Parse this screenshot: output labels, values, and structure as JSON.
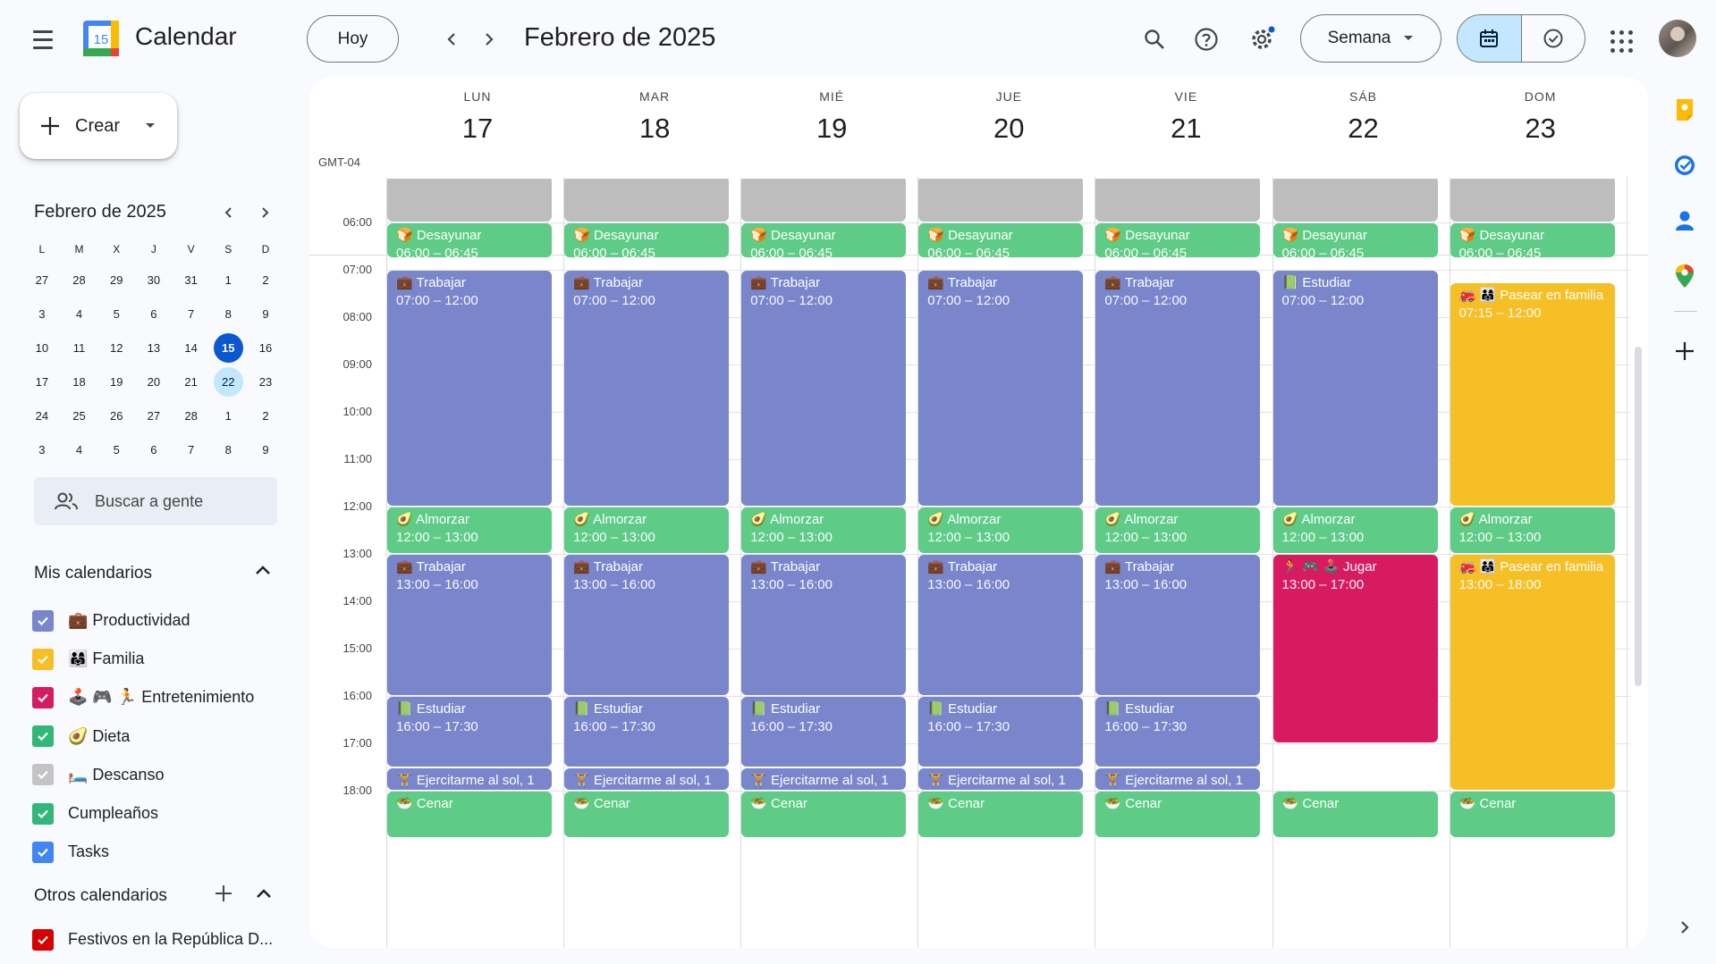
{
  "app": {
    "title": "Calendar",
    "logo_day": "15"
  },
  "header": {
    "today_label": "Hoy",
    "period_title": "Febrero de 2025",
    "view_label": "Semana"
  },
  "sidebar": {
    "create_label": "Crear",
    "mini_month": "Febrero de 2025",
    "mini_dow": [
      "L",
      "M",
      "X",
      "J",
      "V",
      "S",
      "D"
    ],
    "mini_weeks": [
      [
        "27",
        "28",
        "29",
        "30",
        "31",
        "1",
        "2"
      ],
      [
        "3",
        "4",
        "5",
        "6",
        "7",
        "8",
        "9"
      ],
      [
        "10",
        "11",
        "12",
        "13",
        "14",
        "15",
        "16"
      ],
      [
        "17",
        "18",
        "19",
        "20",
        "21",
        "22",
        "23"
      ],
      [
        "24",
        "25",
        "26",
        "27",
        "28",
        "1",
        "2"
      ],
      [
        "3",
        "4",
        "5",
        "6",
        "7",
        "8",
        "9"
      ]
    ],
    "today_date": "15",
    "selected_date": "22",
    "people_search_placeholder": "Buscar a gente",
    "my_calendars_title": "Mis calendarios",
    "my_calendars": [
      {
        "label": "💼 Productividad",
        "color": "#7986cb"
      },
      {
        "label": "👨‍👩‍👧 Familia",
        "color": "#f6bf26"
      },
      {
        "label": "🕹️ 🎮 🏃 Entretenimiento",
        "color": "#d81b60"
      },
      {
        "label": "🥑 Dieta",
        "color": "#33b679"
      },
      {
        "label": "🛏️ Descanso",
        "color": "#c4c4c4"
      },
      {
        "label": "Cumpleaños",
        "color": "#33b679"
      },
      {
        "label": "Tasks",
        "color": "#4285f4"
      }
    ],
    "other_calendars_title": "Otros calendarios",
    "other_calendars": [
      {
        "label": "Festivos en la República D...",
        "color": "#d50000"
      }
    ]
  },
  "week": {
    "timezone": "GMT-04",
    "days": [
      {
        "name": "LUN",
        "num": "17"
      },
      {
        "name": "MAR",
        "num": "18"
      },
      {
        "name": "MIÉ",
        "num": "19"
      },
      {
        "name": "JUE",
        "num": "20"
      },
      {
        "name": "VIE",
        "num": "21"
      },
      {
        "name": "SÁB",
        "num": "22"
      },
      {
        "name": "DOM",
        "num": "23"
      }
    ],
    "hours": [
      "06:00",
      "07:00",
      "08:00",
      "09:00",
      "10:00",
      "11:00",
      "12:00",
      "13:00",
      "14:00",
      "15:00",
      "16:00",
      "17:00",
      "18:00"
    ],
    "events": [
      {
        "day": 0,
        "title": "",
        "start": "05:00",
        "end": "06:00",
        "color": "#bdbdbd"
      },
      {
        "day": 1,
        "title": "",
        "start": "05:00",
        "end": "06:00",
        "color": "#bdbdbd"
      },
      {
        "day": 2,
        "title": "",
        "start": "05:00",
        "end": "06:00",
        "color": "#bdbdbd"
      },
      {
        "day": 3,
        "title": "",
        "start": "05:00",
        "end": "06:00",
        "color": "#bdbdbd"
      },
      {
        "day": 4,
        "title": "",
        "start": "05:00",
        "end": "06:00",
        "color": "#bdbdbd"
      },
      {
        "day": 5,
        "title": "",
        "start": "05:00",
        "end": "06:00",
        "color": "#bdbdbd"
      },
      {
        "day": 6,
        "title": "",
        "start": "05:00",
        "end": "06:00",
        "color": "#bdbdbd"
      },
      {
        "day": 0,
        "title": "🍞 Desayunar",
        "time": "06:00 – 06:45",
        "start": "06:00",
        "end": "06:45",
        "color": "#5ecb86"
      },
      {
        "day": 1,
        "title": "🍞 Desayunar",
        "time": "06:00 – 06:45",
        "start": "06:00",
        "end": "06:45",
        "color": "#5ecb86"
      },
      {
        "day": 2,
        "title": "🍞 Desayunar",
        "time": "06:00 – 06:45",
        "start": "06:00",
        "end": "06:45",
        "color": "#5ecb86"
      },
      {
        "day": 3,
        "title": "🍞 Desayunar",
        "time": "06:00 – 06:45",
        "start": "06:00",
        "end": "06:45",
        "color": "#5ecb86"
      },
      {
        "day": 4,
        "title": "🍞 Desayunar",
        "time": "06:00 – 06:45",
        "start": "06:00",
        "end": "06:45",
        "color": "#5ecb86"
      },
      {
        "day": 5,
        "title": "🍞 Desayunar",
        "time": "06:00 – 06:45",
        "start": "06:00",
        "end": "06:45",
        "color": "#5ecb86"
      },
      {
        "day": 6,
        "title": "🍞 Desayunar",
        "time": "06:00 – 06:45",
        "start": "06:00",
        "end": "06:45",
        "color": "#5ecb86"
      },
      {
        "day": 0,
        "title": "💼 Trabajar",
        "time": "07:00 – 12:00",
        "start": "07:00",
        "end": "12:00",
        "color": "#7986cb"
      },
      {
        "day": 1,
        "title": "💼 Trabajar",
        "time": "07:00 – 12:00",
        "start": "07:00",
        "end": "12:00",
        "color": "#7986cb"
      },
      {
        "day": 2,
        "title": "💼 Trabajar",
        "time": "07:00 – 12:00",
        "start": "07:00",
        "end": "12:00",
        "color": "#7986cb"
      },
      {
        "day": 3,
        "title": "💼 Trabajar",
        "time": "07:00 – 12:00",
        "start": "07:00",
        "end": "12:00",
        "color": "#7986cb"
      },
      {
        "day": 4,
        "title": "💼 Trabajar",
        "time": "07:00 – 12:00",
        "start": "07:00",
        "end": "12:00",
        "color": "#7986cb"
      },
      {
        "day": 5,
        "title": "📗 Estudiar",
        "time": "07:00 – 12:00",
        "start": "07:00",
        "end": "12:00",
        "color": "#7986cb"
      },
      {
        "day": 6,
        "title": "🚒 👨‍👩‍👧 Pasear en familia",
        "time": "07:15 – 12:00",
        "start": "07:15",
        "end": "12:00",
        "color": "#f6bf26",
        "wrap": true
      },
      {
        "day": 0,
        "title": "🥑 Almorzar",
        "time": "12:00 – 13:00",
        "start": "12:00",
        "end": "13:00",
        "color": "#5ecb86"
      },
      {
        "day": 1,
        "title": "🥑 Almorzar",
        "time": "12:00 – 13:00",
        "start": "12:00",
        "end": "13:00",
        "color": "#5ecb86"
      },
      {
        "day": 2,
        "title": "🥑 Almorzar",
        "time": "12:00 – 13:00",
        "start": "12:00",
        "end": "13:00",
        "color": "#5ecb86"
      },
      {
        "day": 3,
        "title": "🥑 Almorzar",
        "time": "12:00 – 13:00",
        "start": "12:00",
        "end": "13:00",
        "color": "#5ecb86"
      },
      {
        "day": 4,
        "title": "🥑 Almorzar",
        "time": "12:00 – 13:00",
        "start": "12:00",
        "end": "13:00",
        "color": "#5ecb86"
      },
      {
        "day": 5,
        "title": "🥑 Almorzar",
        "time": "12:00 – 13:00",
        "start": "12:00",
        "end": "13:00",
        "color": "#5ecb86"
      },
      {
        "day": 6,
        "title": "🥑 Almorzar",
        "time": "12:00 – 13:00",
        "start": "12:00",
        "end": "13:00",
        "color": "#5ecb86"
      },
      {
        "day": 0,
        "title": "💼 Trabajar",
        "time": "13:00 – 16:00",
        "start": "13:00",
        "end": "16:00",
        "color": "#7986cb"
      },
      {
        "day": 1,
        "title": "💼 Trabajar",
        "time": "13:00 – 16:00",
        "start": "13:00",
        "end": "16:00",
        "color": "#7986cb"
      },
      {
        "day": 2,
        "title": "💼 Trabajar",
        "time": "13:00 – 16:00",
        "start": "13:00",
        "end": "16:00",
        "color": "#7986cb"
      },
      {
        "day": 3,
        "title": "💼 Trabajar",
        "time": "13:00 – 16:00",
        "start": "13:00",
        "end": "16:00",
        "color": "#7986cb"
      },
      {
        "day": 4,
        "title": "💼 Trabajar",
        "time": "13:00 – 16:00",
        "start": "13:00",
        "end": "16:00",
        "color": "#7986cb"
      },
      {
        "day": 5,
        "title": "🏃 🎮 🕹️ Jugar",
        "time": "13:00 – 17:00",
        "start": "13:00",
        "end": "17:00",
        "color": "#d81b60"
      },
      {
        "day": 6,
        "title": "🚒 👨‍👩‍👧 Pasear en familia",
        "time": "13:00 – 18:00",
        "start": "13:00",
        "end": "18:00",
        "color": "#f6bf26",
        "wrap": true
      },
      {
        "day": 0,
        "title": "📗 Estudiar",
        "time": "16:00 – 17:30",
        "start": "16:00",
        "end": "17:30",
        "color": "#7986cb"
      },
      {
        "day": 1,
        "title": "📗 Estudiar",
        "time": "16:00 – 17:30",
        "start": "16:00",
        "end": "17:30",
        "color": "#7986cb"
      },
      {
        "day": 2,
        "title": "📗 Estudiar",
        "time": "16:00 – 17:30",
        "start": "16:00",
        "end": "17:30",
        "color": "#7986cb"
      },
      {
        "day": 3,
        "title": "📗 Estudiar",
        "time": "16:00 – 17:30",
        "start": "16:00",
        "end": "17:30",
        "color": "#7986cb"
      },
      {
        "day": 4,
        "title": "📗 Estudiar",
        "time": "16:00 – 17:30",
        "start": "16:00",
        "end": "17:30",
        "color": "#7986cb"
      },
      {
        "day": 0,
        "title": "🏋️ Ejercitarme al sol, 1",
        "start": "17:30",
        "end": "18:00",
        "color": "#7986cb"
      },
      {
        "day": 1,
        "title": "🏋️ Ejercitarme al sol, 1",
        "start": "17:30",
        "end": "18:00",
        "color": "#7986cb"
      },
      {
        "day": 2,
        "title": "🏋️ Ejercitarme al sol, 1",
        "start": "17:30",
        "end": "18:00",
        "color": "#7986cb"
      },
      {
        "day": 3,
        "title": "🏋️ Ejercitarme al sol, 1",
        "start": "17:30",
        "end": "18:00",
        "color": "#7986cb"
      },
      {
        "day": 4,
        "title": "🏋️ Ejercitarme al sol, 1",
        "start": "17:30",
        "end": "18:00",
        "color": "#7986cb"
      },
      {
        "day": 0,
        "title": "🥗 Cenar",
        "start": "18:00",
        "end": "19:00",
        "color": "#5ecb86"
      },
      {
        "day": 1,
        "title": "🥗 Cenar",
        "start": "18:00",
        "end": "19:00",
        "color": "#5ecb86"
      },
      {
        "day": 2,
        "title": "🥗 Cenar",
        "start": "18:00",
        "end": "19:00",
        "color": "#5ecb86"
      },
      {
        "day": 3,
        "title": "🥗 Cenar",
        "start": "18:00",
        "end": "19:00",
        "color": "#5ecb86"
      },
      {
        "day": 4,
        "title": "🥗 Cenar",
        "start": "18:00",
        "end": "19:00",
        "color": "#5ecb86"
      },
      {
        "day": 5,
        "title": "🥗 Cenar",
        "start": "18:00",
        "end": "19:00",
        "color": "#5ecb86"
      },
      {
        "day": 6,
        "title": "🥗 Cenar",
        "start": "18:00",
        "end": "19:00",
        "color": "#5ecb86"
      }
    ]
  },
  "right_rail": {
    "icons": [
      "keep-icon",
      "tasks-icon",
      "contacts-icon",
      "maps-icon",
      "add-addon-icon",
      "expand-panel-icon"
    ]
  }
}
